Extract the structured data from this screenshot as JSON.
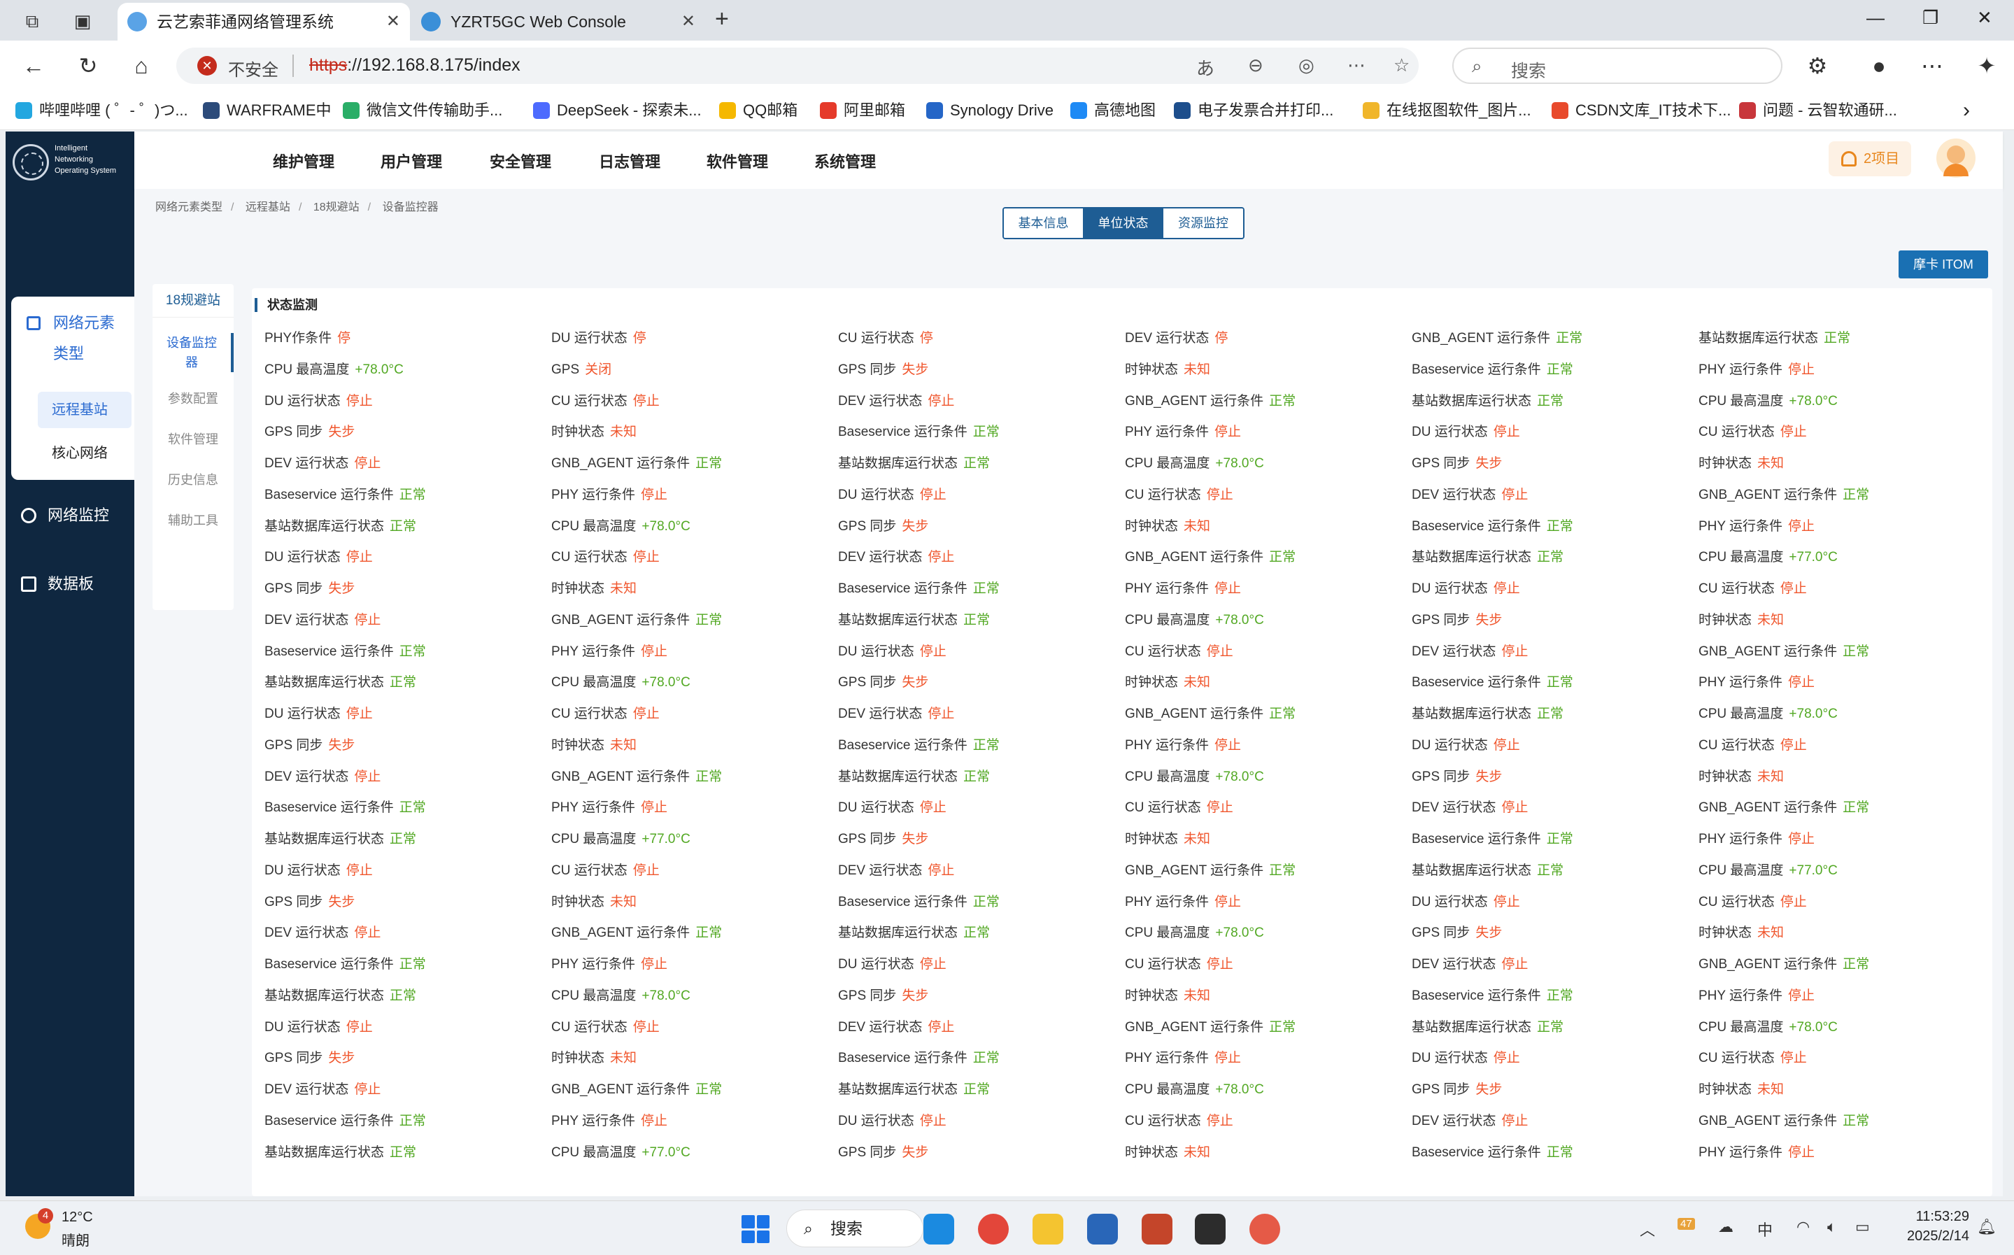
{
  "browser": {
    "tabs": [
      {
        "label": "云艺索菲通网络管理系统",
        "active": true
      },
      {
        "label": "YZRT5GC Web Console",
        "active": false
      }
    ],
    "url_security": "不安全",
    "url_scheme": "https",
    "url_rest": "://192.168.8.175/index",
    "search_placeholder": "搜索",
    "bookmarks": [
      "哔哩哔哩 ( ゜- ゜)つ...",
      "WARFRAME中",
      "微信文件传输助手...",
      "DeepSeek - 探索未...",
      "QQ邮箱",
      "阿里邮箱",
      "Synology Drive",
      "高德地图",
      "电子发票合并打印...",
      "在线抠图软件_图片...",
      "CSDN文库_IT技术下...",
      "问题 - 云智软通研..."
    ]
  },
  "app": {
    "logo_lines": [
      "Intelligent",
      "Networking",
      "Operating System"
    ],
    "sidebar": {
      "section_line1": "网络元素",
      "section_line2": "类型",
      "sub_items": [
        "远程基站",
        "核心网络"
      ],
      "links": [
        "网络监控",
        "数据板"
      ]
    },
    "topnav": [
      "维护管理",
      "用户管理",
      "安全管理",
      "日志管理",
      "软件管理",
      "系统管理"
    ],
    "alert_badge": "2项目",
    "breadcrumb": [
      "网络元素类型",
      "远程基站",
      "18规避站",
      "设备监控器"
    ],
    "view_tabs": [
      "基本信息",
      "单位状态",
      "资源监控"
    ],
    "itom_button": "摩卡 ITOM",
    "subnav": {
      "header": "18规避站",
      "items": [
        "设备监控\n器",
        "参数配置",
        "软件管理",
        "历史信息",
        "辅助工具"
      ]
    },
    "panel_title": "状态监测",
    "status_colors": {
      "ok": "#52a823",
      "bad": "#f0562d"
    },
    "status_rows": [
      [
        [
          "PHY作条件",
          "停"
        ],
        [
          "DU 运行状态",
          "停"
        ],
        [
          "CU 运行状态",
          "停"
        ],
        [
          "DEV 运行状态",
          "停"
        ],
        [
          "GNB_AGENT 运行条件",
          "正常"
        ],
        [
          "基站数据库运行状态",
          "正常"
        ]
      ],
      [
        [
          "CPU 最高温度",
          "+78.0°C"
        ],
        [
          "GPS",
          "关闭"
        ],
        [
          "GPS 同步",
          "失步"
        ],
        [
          "时钟状态",
          "未知"
        ],
        [
          "Baseservice 运行条件",
          "正常"
        ],
        [
          "PHY 运行条件",
          "停止"
        ]
      ],
      [
        [
          "DU 运行状态",
          "停止"
        ],
        [
          "CU 运行状态",
          "停止"
        ],
        [
          "DEV 运行状态",
          "停止"
        ],
        [
          "GNB_AGENT 运行条件",
          "正常"
        ],
        [
          "基站数据库运行状态",
          "正常"
        ],
        [
          "CPU 最高温度",
          "+78.0°C"
        ]
      ],
      [
        [
          "GPS 同步",
          "失步"
        ],
        [
          "时钟状态",
          "未知"
        ],
        [
          "Baseservice 运行条件",
          "正常"
        ],
        [
          "PHY 运行条件",
          "停止"
        ],
        [
          "DU 运行状态",
          "停止"
        ],
        [
          "CU 运行状态",
          "停止"
        ]
      ],
      [
        [
          "DEV 运行状态",
          "停止"
        ],
        [
          "GNB_AGENT 运行条件",
          "正常"
        ],
        [
          "基站数据库运行状态",
          "正常"
        ],
        [
          "CPU 最高温度",
          "+78.0°C"
        ],
        [
          "GPS 同步",
          "失步"
        ],
        [
          "时钟状态",
          "未知"
        ]
      ],
      [
        [
          "Baseservice 运行条件",
          "正常"
        ],
        [
          "PHY 运行条件",
          "停止"
        ],
        [
          "DU 运行状态",
          "停止"
        ],
        [
          "CU 运行状态",
          "停止"
        ],
        [
          "DEV 运行状态",
          "停止"
        ],
        [
          "GNB_AGENT 运行条件",
          "正常"
        ]
      ],
      [
        [
          "基站数据库运行状态",
          "正常"
        ],
        [
          "CPU 最高温度",
          "+78.0°C"
        ],
        [
          "GPS 同步",
          "失步"
        ],
        [
          "时钟状态",
          "未知"
        ],
        [
          "Baseservice 运行条件",
          "正常"
        ],
        [
          "PHY 运行条件",
          "停止"
        ]
      ],
      [
        [
          "DU 运行状态",
          "停止"
        ],
        [
          "CU 运行状态",
          "停止"
        ],
        [
          "DEV 运行状态",
          "停止"
        ],
        [
          "GNB_AGENT 运行条件",
          "正常"
        ],
        [
          "基站数据库运行状态",
          "正常"
        ],
        [
          "CPU 最高温度",
          "+77.0°C"
        ]
      ],
      [
        [
          "GPS 同步",
          "失步"
        ],
        [
          "时钟状态",
          "未知"
        ],
        [
          "Baseservice 运行条件",
          "正常"
        ],
        [
          "PHY 运行条件",
          "停止"
        ],
        [
          "DU 运行状态",
          "停止"
        ],
        [
          "CU 运行状态",
          "停止"
        ]
      ],
      [
        [
          "DEV 运行状态",
          "停止"
        ],
        [
          "GNB_AGENT 运行条件",
          "正常"
        ],
        [
          "基站数据库运行状态",
          "正常"
        ],
        [
          "CPU 最高温度",
          "+78.0°C"
        ],
        [
          "GPS 同步",
          "失步"
        ],
        [
          "时钟状态",
          "未知"
        ]
      ],
      [
        [
          "Baseservice 运行条件",
          "正常"
        ],
        [
          "PHY 运行条件",
          "停止"
        ],
        [
          "DU 运行状态",
          "停止"
        ],
        [
          "CU 运行状态",
          "停止"
        ],
        [
          "DEV 运行状态",
          "停止"
        ],
        [
          "GNB_AGENT 运行条件",
          "正常"
        ]
      ],
      [
        [
          "基站数据库运行状态",
          "正常"
        ],
        [
          "CPU 最高温度",
          "+78.0°C"
        ],
        [
          "GPS 同步",
          "失步"
        ],
        [
          "时钟状态",
          "未知"
        ],
        [
          "Baseservice 运行条件",
          "正常"
        ],
        [
          "PHY 运行条件",
          "停止"
        ]
      ],
      [
        [
          "DU 运行状态",
          "停止"
        ],
        [
          "CU 运行状态",
          "停止"
        ],
        [
          "DEV 运行状态",
          "停止"
        ],
        [
          "GNB_AGENT 运行条件",
          "正常"
        ],
        [
          "基站数据库运行状态",
          "正常"
        ],
        [
          "CPU 最高温度",
          "+78.0°C"
        ]
      ],
      [
        [
          "GPS 同步",
          "失步"
        ],
        [
          "时钟状态",
          "未知"
        ],
        [
          "Baseservice 运行条件",
          "正常"
        ],
        [
          "PHY 运行条件",
          "停止"
        ],
        [
          "DU 运行状态",
          "停止"
        ],
        [
          "CU 运行状态",
          "停止"
        ]
      ],
      [
        [
          "DEV 运行状态",
          "停止"
        ],
        [
          "GNB_AGENT 运行条件",
          "正常"
        ],
        [
          "基站数据库运行状态",
          "正常"
        ],
        [
          "CPU 最高温度",
          "+78.0°C"
        ],
        [
          "GPS 同步",
          "失步"
        ],
        [
          "时钟状态",
          "未知"
        ]
      ],
      [
        [
          "Baseservice 运行条件",
          "正常"
        ],
        [
          "PHY 运行条件",
          "停止"
        ],
        [
          "DU 运行状态",
          "停止"
        ],
        [
          "CU 运行状态",
          "停止"
        ],
        [
          "DEV 运行状态",
          "停止"
        ],
        [
          "GNB_AGENT 运行条件",
          "正常"
        ]
      ],
      [
        [
          "基站数据库运行状态",
          "正常"
        ],
        [
          "CPU 最高温度",
          "+77.0°C"
        ],
        [
          "GPS 同步",
          "失步"
        ],
        [
          "时钟状态",
          "未知"
        ],
        [
          "Baseservice 运行条件",
          "正常"
        ],
        [
          "PHY 运行条件",
          "停止"
        ]
      ],
      [
        [
          "DU 运行状态",
          "停止"
        ],
        [
          "CU 运行状态",
          "停止"
        ],
        [
          "DEV 运行状态",
          "停止"
        ],
        [
          "GNB_AGENT 运行条件",
          "正常"
        ],
        [
          "基站数据库运行状态",
          "正常"
        ],
        [
          "CPU 最高温度",
          "+77.0°C"
        ]
      ],
      [
        [
          "GPS 同步",
          "失步"
        ],
        [
          "时钟状态",
          "未知"
        ],
        [
          "Baseservice 运行条件",
          "正常"
        ],
        [
          "PHY 运行条件",
          "停止"
        ],
        [
          "DU 运行状态",
          "停止"
        ],
        [
          "CU 运行状态",
          "停止"
        ]
      ],
      [
        [
          "DEV 运行状态",
          "停止"
        ],
        [
          "GNB_AGENT 运行条件",
          "正常"
        ],
        [
          "基站数据库运行状态",
          "正常"
        ],
        [
          "CPU 最高温度",
          "+78.0°C"
        ],
        [
          "GPS 同步",
          "失步"
        ],
        [
          "时钟状态",
          "未知"
        ]
      ],
      [
        [
          "Baseservice 运行条件",
          "正常"
        ],
        [
          "PHY 运行条件",
          "停止"
        ],
        [
          "DU 运行状态",
          "停止"
        ],
        [
          "CU 运行状态",
          "停止"
        ],
        [
          "DEV 运行状态",
          "停止"
        ],
        [
          "GNB_AGENT 运行条件",
          "正常"
        ]
      ],
      [
        [
          "基站数据库运行状态",
          "正常"
        ],
        [
          "CPU 最高温度",
          "+78.0°C"
        ],
        [
          "GPS 同步",
          "失步"
        ],
        [
          "时钟状态",
          "未知"
        ],
        [
          "Baseservice 运行条件",
          "正常"
        ],
        [
          "PHY 运行条件",
          "停止"
        ]
      ],
      [
        [
          "DU 运行状态",
          "停止"
        ],
        [
          "CU 运行状态",
          "停止"
        ],
        [
          "DEV 运行状态",
          "停止"
        ],
        [
          "GNB_AGENT 运行条件",
          "正常"
        ],
        [
          "基站数据库运行状态",
          "正常"
        ],
        [
          "CPU 最高温度",
          "+78.0°C"
        ]
      ],
      [
        [
          "GPS 同步",
          "失步"
        ],
        [
          "时钟状态",
          "未知"
        ],
        [
          "Baseservice 运行条件",
          "正常"
        ],
        [
          "PHY 运行条件",
          "停止"
        ],
        [
          "DU 运行状态",
          "停止"
        ],
        [
          "CU 运行状态",
          "停止"
        ]
      ],
      [
        [
          "DEV 运行状态",
          "停止"
        ],
        [
          "GNB_AGENT 运行条件",
          "正常"
        ],
        [
          "基站数据库运行状态",
          "正常"
        ],
        [
          "CPU 最高温度",
          "+78.0°C"
        ],
        [
          "GPS 同步",
          "失步"
        ],
        [
          "时钟状态",
          "未知"
        ]
      ],
      [
        [
          "Baseservice 运行条件",
          "正常"
        ],
        [
          "PHY 运行条件",
          "停止"
        ],
        [
          "DU 运行状态",
          "停止"
        ],
        [
          "CU 运行状态",
          "停止"
        ],
        [
          "DEV 运行状态",
          "停止"
        ],
        [
          "GNB_AGENT 运行条件",
          "正常"
        ]
      ],
      [
        [
          "基站数据库运行状态",
          "正常"
        ],
        [
          "CPU 最高温度",
          "+77.0°C"
        ],
        [
          "GPS 同步",
          "失步"
        ],
        [
          "时钟状态",
          "未知"
        ],
        [
          "Baseservice 运行条件",
          "正常"
        ],
        [
          "PHY 运行条件",
          "停止"
        ]
      ]
    ]
  },
  "taskbar": {
    "weather_badge": "4",
    "weather_temp": "12°C",
    "weather_desc": "晴朗",
    "search_label": "搜索",
    "tray_badge": "47",
    "ime": "中",
    "time": "11:53:29",
    "date": "2025/2/14"
  }
}
